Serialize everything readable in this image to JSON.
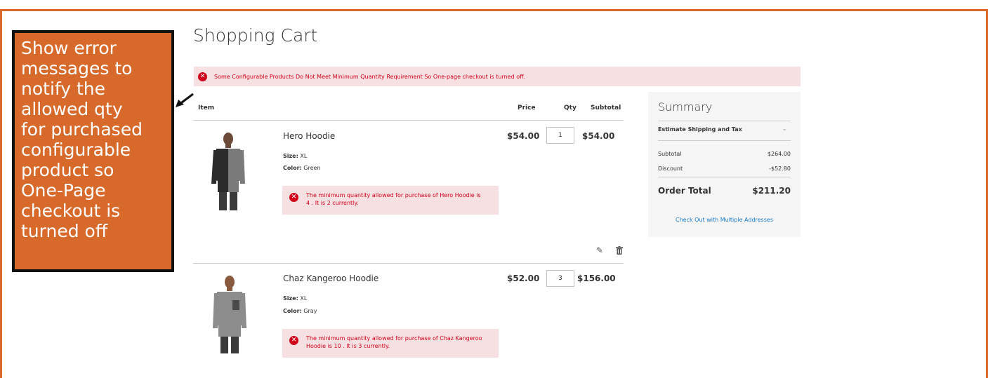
{
  "annotation": {
    "lines": [
      "Show error",
      "messages to",
      "notify the",
      "allowed qty",
      "for purchased",
      "configurable",
      "product so",
      "One-Page",
      "checkout is",
      "turned off"
    ]
  },
  "page": {
    "title": "Shopping Cart",
    "global_error": "Some Configurable Products Do Not Meet Minimum Quantity Requirement So One-page checkout is turned off."
  },
  "table": {
    "headers": {
      "item": "Item",
      "price": "Price",
      "qty": "Qty",
      "subtotal": "Subtotal"
    }
  },
  "items": [
    {
      "name": "Hero Hoodie",
      "size_label": "Size:",
      "size": "XL",
      "color_label": "Color:",
      "color": "Green",
      "price": "$54.00",
      "qty": "1",
      "subtotal": "$54.00",
      "error_line1": "The minimum quantity allowed for purchase of Hero Hoodie is",
      "error_line2": "4 . It is 2 currently."
    },
    {
      "name": "Chaz Kangeroo Hoodie",
      "size_label": "Size:",
      "size": "XL",
      "color_label": "Color:",
      "color": "Gray",
      "price": "$52.00",
      "qty": "3",
      "subtotal": "$156.00",
      "error_line1": "The minimum quantity allowed for purchase of Chaz Kangeroo",
      "error_line2": "Hoodie is 10 . It is 3 currently."
    }
  ],
  "summary": {
    "title": "Summary",
    "shipping": "Estimate Shipping and Tax",
    "subtotal_label": "Subtotal",
    "subtotal": "$264.00",
    "discount_label": "Discount",
    "discount": "-$52.80",
    "total_label": "Order Total",
    "total": "$211.20",
    "multi_link": "Check Out with Multiple Addresses"
  },
  "icons": {
    "error": "error-icon",
    "edit": "pencil-icon",
    "delete": "trash-icon",
    "expand": "chevron-down-icon"
  },
  "colors": {
    "accent_orange": "#d76a2b",
    "error_bg": "#f7e0e1",
    "error_text": "#d0021b",
    "link": "#1979c3",
    "summary_bg": "#f5f5f5"
  }
}
